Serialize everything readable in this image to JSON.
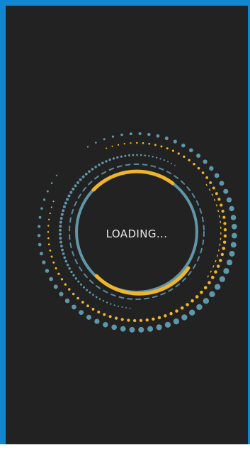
{
  "screen": {
    "status_text": "LOADING..."
  },
  "colors": {
    "frame": "#1187cf",
    "background": "#222222",
    "accent_teal": "#5f97a8",
    "accent_yellow": "#f0b62a",
    "text": "#e8e8e8"
  },
  "icon": "circular-loading-spinner"
}
